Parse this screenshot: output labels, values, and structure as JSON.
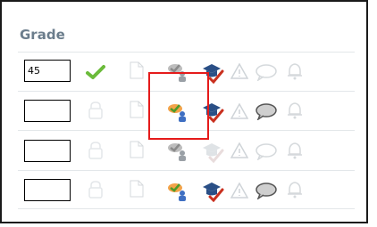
{
  "table": {
    "header": "Grade",
    "rows": [
      {
        "grade_value": "45",
        "status_icon": "checkmark-icon",
        "status_color": "#6bbb3a",
        "bell_active": false,
        "comment_active": false,
        "cap_active": true,
        "assign_active": false
      },
      {
        "grade_value": "",
        "status_icon": "lock-icon",
        "bell_active": false,
        "comment_active": true,
        "cap_active": true,
        "assign_active": true
      },
      {
        "grade_value": "",
        "status_icon": "lock-icon",
        "bell_active": false,
        "comment_active": false,
        "cap_active": false,
        "assign_active": false
      },
      {
        "grade_value": "",
        "status_icon": "lock-icon",
        "bell_active": false,
        "comment_active": true,
        "cap_active": true,
        "assign_active": true
      }
    ]
  },
  "colors": {
    "header_text": "#6b7d8c",
    "highlight_box": "#e51b1b",
    "cap_blue": "#2a4f86",
    "check_red": "#c9301f",
    "faded_icon": "#cfd4d8"
  }
}
